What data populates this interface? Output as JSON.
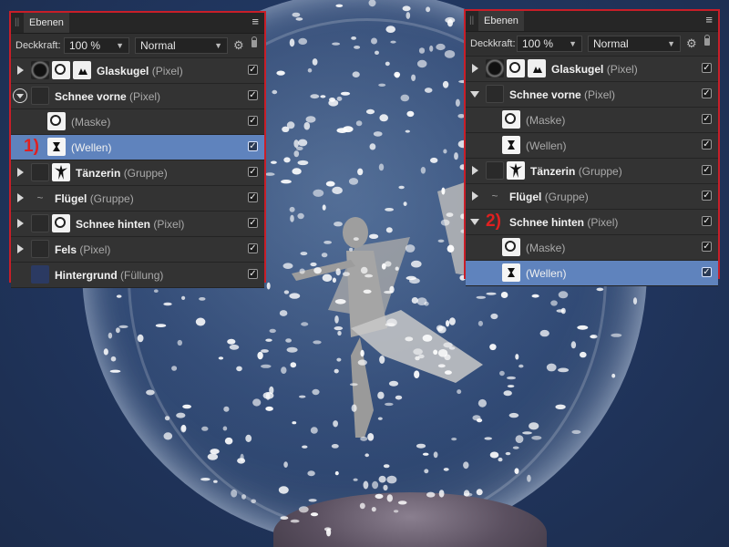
{
  "left_panel": {
    "tab_title": "Ebenen",
    "menu_icon": "hamburger-icon",
    "opacity_label": "Deckkraft:",
    "opacity_value": "100 %",
    "blend_mode": "Normal",
    "layers": [
      {
        "name": "Glaskugel",
        "kind": "(Pixel)",
        "expander": "right",
        "thumbs": [
          "ball",
          "white",
          "spark"
        ],
        "checked": true
      },
      {
        "name": "Schnee vorne",
        "kind": "(Pixel)",
        "expander": "circle",
        "thumbs": [
          "dark"
        ],
        "checked": true
      },
      {
        "name": "",
        "kind": "(Maske)",
        "expander": "none",
        "thumbs": [
          "white"
        ],
        "checked": true,
        "indent": true
      },
      {
        "name": "",
        "kind": "(Wellen)",
        "expander": "none",
        "thumbs": [
          "wave"
        ],
        "checked": true,
        "indent": true,
        "selected": true,
        "marker": "1)"
      },
      {
        "name": "Tänzerin",
        "kind": "(Gruppe)",
        "expander": "right",
        "thumbs": [
          "dark",
          "dancer"
        ],
        "checked": true
      },
      {
        "name": "Flügel",
        "kind": "(Gruppe)",
        "expander": "right",
        "thumbs": [
          "tilde"
        ],
        "checked": true
      },
      {
        "name": "Schnee hinten",
        "kind": "(Pixel)",
        "expander": "right",
        "thumbs": [
          "dark",
          "white"
        ],
        "checked": true
      },
      {
        "name": "Fels",
        "kind": "(Pixel)",
        "expander": "right",
        "thumbs": [
          "dark"
        ],
        "checked": true
      },
      {
        "name": "Hintergrund",
        "kind": "(Füllung)",
        "expander": "none",
        "thumbs": [
          "navy"
        ],
        "checked": true
      }
    ]
  },
  "right_panel": {
    "tab_title": "Ebenen",
    "menu_icon": "hamburger-icon",
    "opacity_label": "Deckkraft:",
    "opacity_value": "100 %",
    "blend_mode": "Normal",
    "layers": [
      {
        "name": "Glaskugel",
        "kind": "(Pixel)",
        "expander": "right",
        "thumbs": [
          "ball",
          "white",
          "spark"
        ],
        "checked": true
      },
      {
        "name": "Schnee vorne",
        "kind": "(Pixel)",
        "expander": "down",
        "thumbs": [
          "dark"
        ],
        "checked": true
      },
      {
        "name": "",
        "kind": "(Maske)",
        "expander": "none",
        "thumbs": [
          "white"
        ],
        "checked": true,
        "indent": true
      },
      {
        "name": "",
        "kind": "(Wellen)",
        "expander": "none",
        "thumbs": [
          "wave"
        ],
        "checked": true,
        "indent": true
      },
      {
        "name": "Tänzerin",
        "kind": "(Gruppe)",
        "expander": "right",
        "thumbs": [
          "dark",
          "dancer"
        ],
        "checked": true
      },
      {
        "name": "Flügel",
        "kind": "(Gruppe)",
        "expander": "right",
        "thumbs": [
          "tilde"
        ],
        "checked": true
      },
      {
        "name": "Schnee hinten",
        "kind": "(Pixel)",
        "expander": "down",
        "thumbs": [
          "dark"
        ],
        "checked": true,
        "marker": "2)"
      },
      {
        "name": "",
        "kind": "(Maske)",
        "expander": "none",
        "thumbs": [
          "white"
        ],
        "checked": true,
        "indent": true
      },
      {
        "name": "",
        "kind": "(Wellen)",
        "expander": "none",
        "thumbs": [
          "wave"
        ],
        "checked": true,
        "indent": true,
        "selected": true
      }
    ]
  },
  "colors": {
    "panel_bg": "#303030",
    "selection": "#5f83bd",
    "highlight_border": "#c81e28",
    "marker": "#e02020",
    "canvas_bg": "#22324f"
  }
}
